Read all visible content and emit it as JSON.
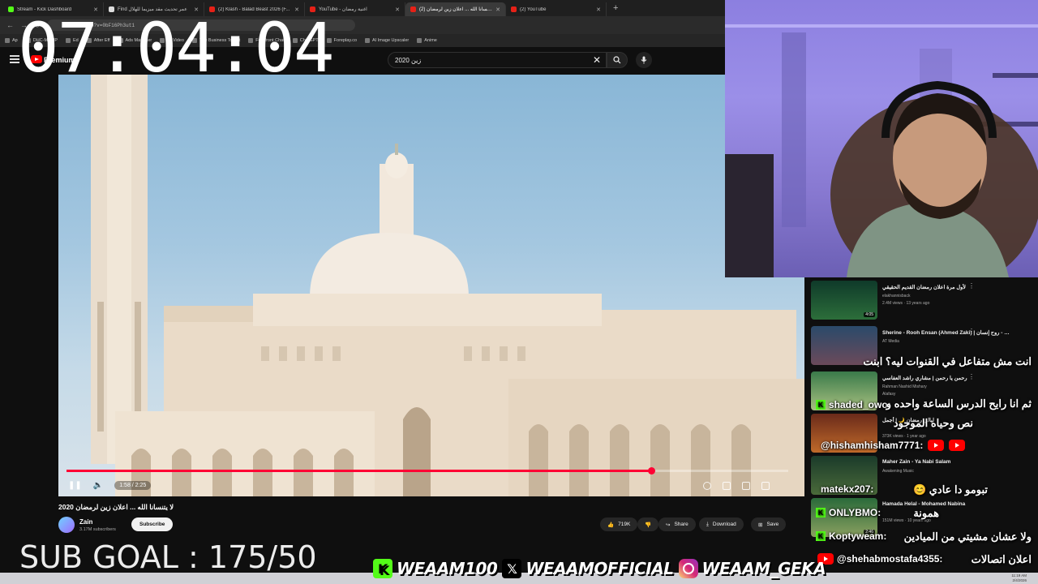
{
  "browser": {
    "tabs": [
      {
        "label": "Stream - Kick Dashboard",
        "icon": "kick"
      },
      {
        "label": "Find عمر تحديث مقد ميزيما للهلال",
        "icon": "doc"
      },
      {
        "label": "(2) Klash - Balad Beast 2026 (F...",
        "icon": "youtube"
      },
      {
        "label": "YouTube - اغنية رمضان",
        "icon": "youtube"
      },
      {
        "label": "(2) لا يتنسانا الله ... اعلان زين لرمضان",
        "icon": "youtube",
        "active": true
      },
      {
        "label": "(2) YouTube",
        "icon": "youtube"
      }
    ],
    "new_tab": "+",
    "url": "watch?v=0bF16Ph3ut1",
    "bookmarks": [
      "Ap",
      "DHC-MOHP",
      "Ed",
      "After Eff",
      "Ads Manager",
      "AI Video",
      "The Business Toolkit",
      "Forefront Chat",
      "ChatGPT",
      "Foreplay.co",
      "AI Image Upscaler",
      "Anime"
    ]
  },
  "youtube": {
    "brand": "Premium",
    "search": {
      "query": "زين 2020",
      "clear": "✕"
    },
    "video": {
      "time": "1:58 / 2:25",
      "progress": 0.81,
      "title": "لا يتنسانا الله ... اعلان زين لرمضان 2020"
    },
    "channel": {
      "name": "Zain",
      "subscribers": "3.17M subscribers",
      "subscribe_label": "Subscribe"
    },
    "actions": {
      "likes": "719K",
      "share": "Share",
      "download": "Download",
      "save": "Save"
    },
    "recommendations": [
      {
        "title": "لأول مرة اعلان رمضان القديم الحقيقي",
        "channel": "elakhannisback",
        "meta": "2.4M views · 13 years ago",
        "duration": "4:05"
      },
      {
        "title": "Sherine - Rooh Ensan (Ahmed Zaki) | شيرين - روح إنسان",
        "channel": "AT Media",
        "meta": "",
        "duration": ""
      },
      {
        "title": "رحمن يا رحمن | مشاري راشد العفاسي",
        "channel": "Alafasy",
        "meta": "Rahman Nashid Mishary",
        "duration": ""
      },
      {
        "title": "ليالي رمضان 🌙 | أجمل",
        "channel": "",
        "meta": "373K views · 1 year ago",
        "duration": ""
      },
      {
        "title": "Maher Zain - Ya Nabi Salam",
        "channel": "Awakening Music",
        "meta": "",
        "duration": ""
      },
      {
        "title": "Hamada Helal - Mohamed Nabina",
        "channel": "",
        "meta": "151M views · 10 years ago",
        "duration": "2:46"
      }
    ]
  },
  "overlay": {
    "timer": "07:04:04",
    "sub_goal": "SUB GOAL : 175/50",
    "socials": {
      "kick": "WEAAM100",
      "x": "WEAAMOFFICIAL",
      "instagram": "WEAAM_GEKA"
    }
  },
  "chat": [
    {
      "user": "",
      "text": "انت مش متفاعل في القنوات ليه؟ ابنت"
    },
    {
      "user": "shaded_owo:",
      "text": "ثم انا رايح الدرس الساعة واحده و"
    },
    {
      "user": "",
      "text": "نص وحياه الموجود"
    },
    {
      "user": "@hishamhisham7771:",
      "text": ""
    },
    {
      "user": "matekx207:",
      "text": "تبومو دا عادي 😊"
    },
    {
      "user": "ONLYBMO:",
      "text": "همونة"
    },
    {
      "user": "Koptyweam:",
      "text": "ولا عشان مشيتي من الميادين"
    },
    {
      "user": "@shehabmostafa4355:",
      "text": "اعلان اتصالات"
    }
  ],
  "system": {
    "clock_time": "11:19 AM",
    "clock_date": "2/4/2026"
  }
}
